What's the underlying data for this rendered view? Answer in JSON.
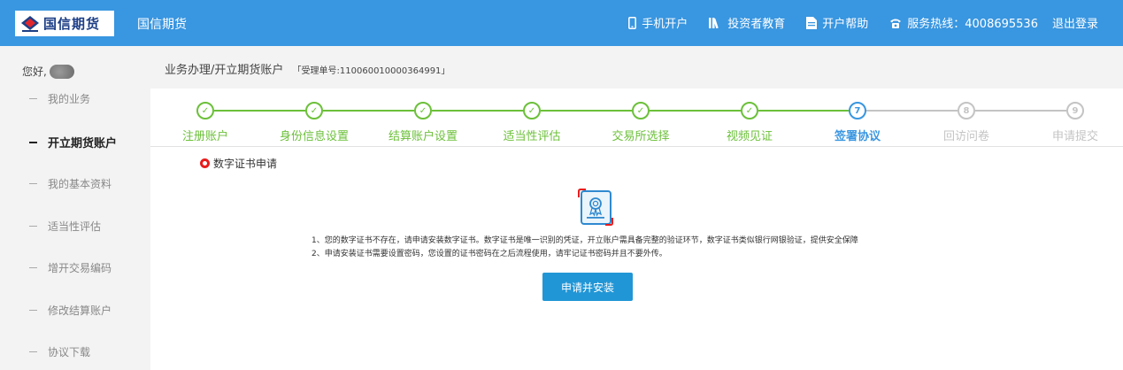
{
  "header": {
    "logo_text": "国信期货",
    "brand": "国信期货",
    "nav": [
      {
        "icon": "phone-icon",
        "label": "手机开户"
      },
      {
        "icon": "books-icon",
        "label": "投资者教育"
      },
      {
        "icon": "document-icon",
        "label": "开户帮助"
      },
      {
        "icon": "telephone-icon",
        "label": "服务热线：4008695536"
      }
    ],
    "logout": "退出登录"
  },
  "sidebar": {
    "greeting": "您好,",
    "items": [
      {
        "label": "我的业务",
        "active": false
      },
      {
        "label": "开立期货账户",
        "active": true
      },
      {
        "label": "我的基本资料",
        "active": false
      },
      {
        "label": "适当性评估",
        "active": false
      },
      {
        "label": "增开交易编码",
        "active": false
      },
      {
        "label": "修改结算账户",
        "active": false
      },
      {
        "label": "协议下载",
        "active": false
      }
    ]
  },
  "breadcrumb": {
    "path": "业务办理/开立期货账户",
    "ticket": "「受理单号:110060010000364991」"
  },
  "steps": [
    {
      "label": "注册账户",
      "status": "done",
      "mark": "✓"
    },
    {
      "label": "身份信息设置",
      "status": "done",
      "mark": "✓"
    },
    {
      "label": "结算账户设置",
      "status": "done",
      "mark": "✓"
    },
    {
      "label": "适当性评估",
      "status": "done",
      "mark": "✓"
    },
    {
      "label": "交易所选择",
      "status": "done",
      "mark": "✓"
    },
    {
      "label": "视频见证",
      "status": "done",
      "mark": "✓"
    },
    {
      "label": "签署协议",
      "status": "current",
      "mark": "7"
    },
    {
      "label": "回访问卷",
      "status": "todo",
      "mark": "8"
    },
    {
      "label": "申请提交",
      "status": "todo",
      "mark": "9"
    }
  ],
  "colors": {
    "done": "#6cc03a",
    "current": "#3996e0",
    "todo": "#c4c4c4",
    "header_bg": "#3996e0",
    "button_bg": "#2196d6"
  },
  "content": {
    "section_title": "数字证书申请",
    "note1": "1、您的数字证书不存在，请申请安装数字证书。数字证书是唯一识别的凭证，开立账户需具备完整的验证环节，数字证书类似银行网银验证，提供安全保障",
    "note2": "2、申请安装证书需要设置密码，您设置的证书密码在之后流程使用，请牢记证书密码并且不要外传。",
    "button": "申请并安装"
  }
}
